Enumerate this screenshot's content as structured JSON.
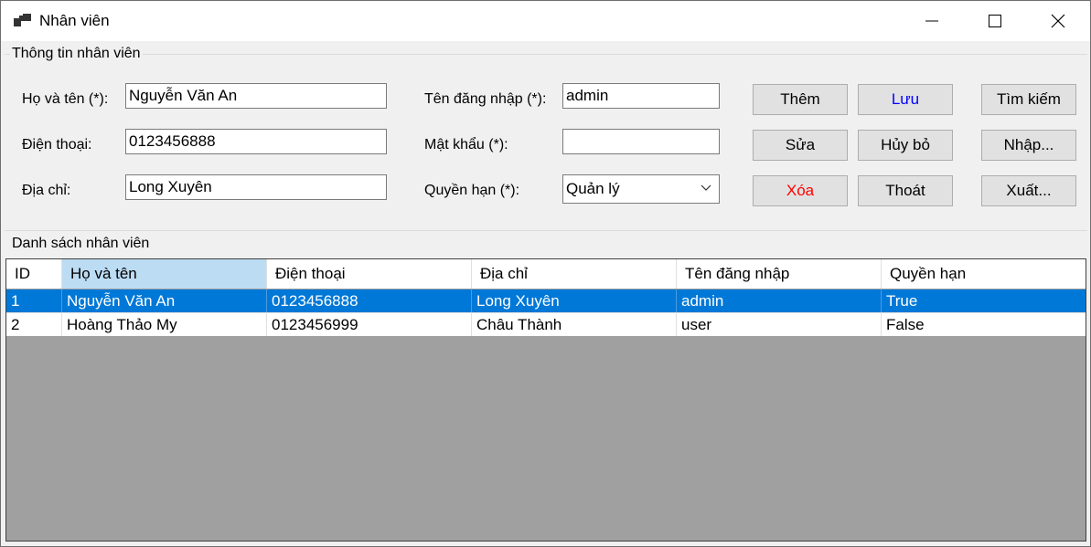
{
  "window": {
    "title": "Nhân viên",
    "icon": "app-window-icon",
    "controls": [
      "minimize-icon",
      "maximize-icon",
      "close-icon"
    ]
  },
  "info_group": {
    "label": "Thông tin nhân viên",
    "ho_ten_label": "Họ và tên (*):",
    "ho_ten_value": "Nguyễn Văn An",
    "dien_thoai_label": "Điện thoại:",
    "dien_thoai_value": "0123456888",
    "dia_chi_label": "Địa chỉ:",
    "dia_chi_value": "Long Xuyên",
    "ten_dang_nhap_label": "Tên đăng nhập (*):",
    "ten_dang_nhap_value": "admin",
    "mat_khau_label": "Mật khẩu (*):",
    "mat_khau_value": "",
    "quyen_han_label": "Quyền hạn (*):",
    "quyen_han_value": "Quản lý"
  },
  "buttons": {
    "them": "Thêm",
    "luu": "Lưu",
    "tim_kiem": "Tìm kiếm",
    "sua": "Sửa",
    "huy_bo": "Hủy bỏ",
    "nhap": "Nhập...",
    "xoa": "Xóa",
    "thoat": "Thoát",
    "xuat": "Xuất..."
  },
  "colors": {
    "luu_text": "#0000ff",
    "xoa_text": "#ff0000",
    "selected_row": "#0078d7",
    "selected_header": "#bcdcf4",
    "grid_background": "#a0a0a0"
  },
  "list_group": {
    "label": "Danh sách nhân viên",
    "columns": [
      "ID",
      "Họ và tên",
      "Điện thoại",
      "Địa chỉ",
      "Tên đăng nhập",
      "Quyền hạn"
    ],
    "rows": [
      [
        "1",
        "Nguyễn Văn An",
        "0123456888",
        "Long Xuyên",
        "admin",
        "True"
      ],
      [
        "2",
        "Hoàng Thảo My",
        "0123456999",
        "Châu Thành",
        "user",
        "False"
      ]
    ]
  }
}
